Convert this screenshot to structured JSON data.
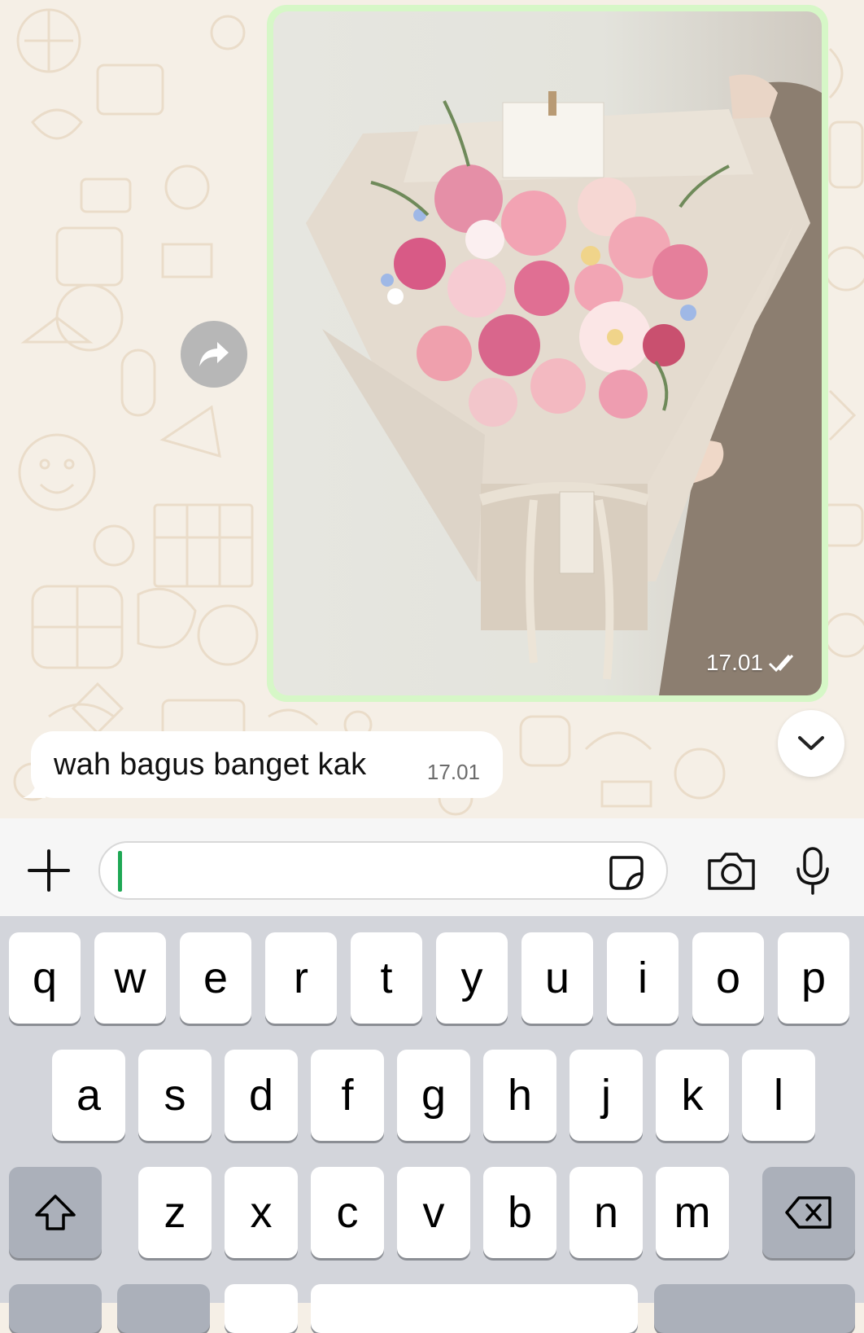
{
  "chat": {
    "image_message": {
      "time": "17.01",
      "status": "read"
    },
    "text_message": {
      "text": "wah bagus banget kak",
      "time": "17.01"
    }
  },
  "composer": {
    "input_value": "",
    "placeholder": ""
  },
  "keyboard": {
    "row1": [
      "q",
      "w",
      "e",
      "r",
      "t",
      "y",
      "u",
      "i",
      "o",
      "p"
    ],
    "row2": [
      "a",
      "s",
      "d",
      "f",
      "g",
      "h",
      "j",
      "k",
      "l"
    ],
    "row3": [
      "z",
      "x",
      "c",
      "v",
      "b",
      "n",
      "m"
    ]
  },
  "colors": {
    "wallpaper": "#f5efe6",
    "outgoing_bubble": "#d6f7c7",
    "incoming_bubble": "#ffffff",
    "caret": "#1fa855",
    "keyboard_bg": "#d3d5db"
  }
}
